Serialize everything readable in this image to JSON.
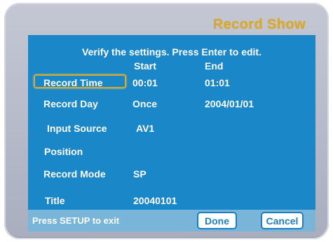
{
  "window": {
    "title": "Record Show"
  },
  "help_text": "Verify the settings. Press Enter to edit.",
  "headers": {
    "start": "Start",
    "end": "End"
  },
  "rows": [
    {
      "label": "Record Time",
      "value": "00:01",
      "value2": "01:01"
    },
    {
      "label": "Record Day",
      "value": "Once",
      "value2": "2004/01/01"
    },
    {
      "label": "Input Source",
      "value": "AV1"
    },
    {
      "label": "Position",
      "value": ""
    },
    {
      "label": "Record Mode",
      "value": "SP"
    },
    {
      "label": "Title",
      "value": "20040101"
    }
  ],
  "footer": {
    "hint": "Press SETUP to exit",
    "done_label": "Done",
    "cancel_label": "Cancel"
  },
  "colors": {
    "panel_blue": "#1a87c8",
    "footer_blue": "#78b5d9",
    "title_gold": "#d8a92c",
    "frame_gray": "#b8bccb",
    "selection_outline": "#d8a92c"
  }
}
